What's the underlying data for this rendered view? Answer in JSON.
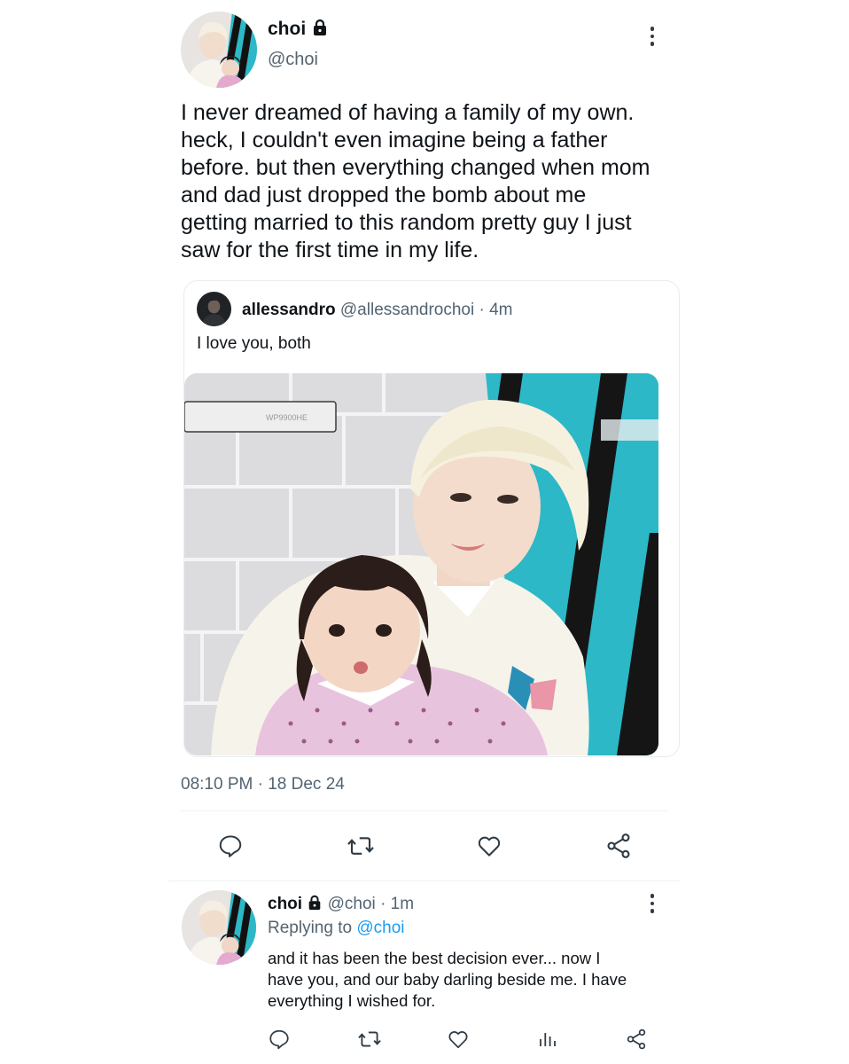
{
  "main_tweet": {
    "display_name": "choi",
    "handle": "@choi",
    "text": "I never dreamed of having a family of my own.\nheck, I couldn't even imagine being a father\nbefore. but then everything changed when mom\nand dad just dropped the bomb about me\ngetting married to this random pretty guy I just\nsaw for the first time in my life.",
    "timestamp": "08:10 PM",
    "date": "18 Dec 24",
    "separator": "·",
    "quoted": {
      "display_name": "allessandro",
      "handle": "@allessandrochoi",
      "time": "4m",
      "text": "I love you, both",
      "image_sign_text": "WP9900HE"
    },
    "actions": [
      "reply-icon",
      "retweet-icon",
      "like-icon",
      "share-icon"
    ]
  },
  "reply_tweet": {
    "display_name": "choi",
    "handle": "@choi",
    "time": "1m",
    "replying_prefix": "Replying to",
    "replying_handle": "@choi",
    "text": "and it has been the best decision ever... now I\nhave you, and our baby darling beside me. I have\neverything I wished for.",
    "actions": [
      "reply-icon",
      "retweet-icon",
      "like-icon",
      "analytics-icon",
      "share-icon"
    ]
  },
  "colors": {
    "text": "#0f1419",
    "muted": "#536471",
    "link": "#1d9bf0",
    "accent_teal": "#2cb8c6"
  }
}
